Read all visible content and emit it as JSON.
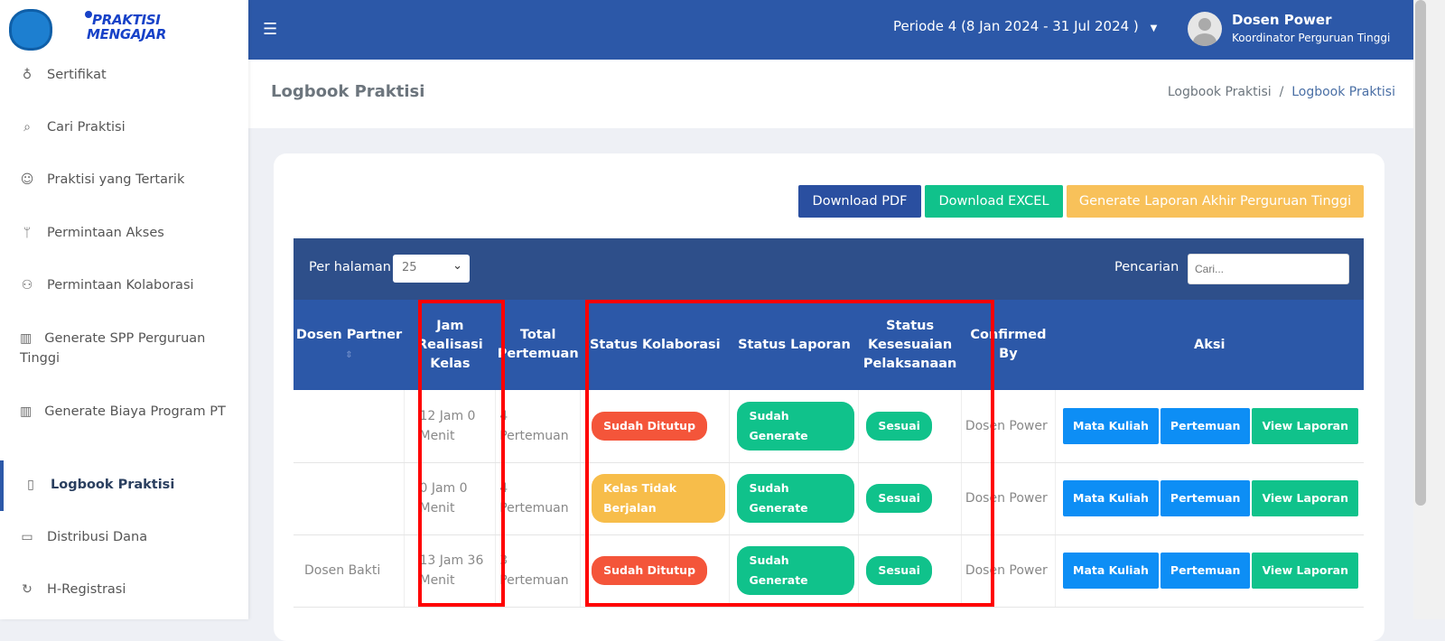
{
  "brand": {
    "logo_text_1": "PRAKTISI",
    "logo_text_2": "MENGAJAR"
  },
  "sidebar": {
    "items": [
      {
        "label": "Sertifikat",
        "icon": "award-icon"
      },
      {
        "label": "Cari Praktisi",
        "icon": "search-icon"
      },
      {
        "label": "Praktisi yang Tertarik",
        "icon": "smile-icon"
      },
      {
        "label": "Permintaan Akses",
        "icon": "antenna-icon"
      },
      {
        "label": "Permintaan Kolaborasi",
        "icon": "users-icon"
      },
      {
        "label": "Generate SPP Perguruan Tinggi",
        "icon": "sliders-icon"
      },
      {
        "label": "Generate Biaya Program PT",
        "icon": "sliders-icon"
      },
      {
        "label": "Logbook Praktisi",
        "icon": "book-icon",
        "active": true
      },
      {
        "label": "Distribusi Dana",
        "icon": "wallet-icon"
      },
      {
        "label": "H-Registrasi",
        "icon": "refresh-icon"
      }
    ]
  },
  "topbar": {
    "periode": "Periode 4 (8 Jan 2024 - 31 Jul 2024 )",
    "user_name": "Dosen Power",
    "user_role": "Koordinator Perguruan Tinggi"
  },
  "page": {
    "title": "Logbook Praktisi",
    "breadcrumb": [
      "Logbook Praktisi",
      "Logbook Praktisi"
    ]
  },
  "actions": {
    "pdf": "Download PDF",
    "excel": "Download EXCEL",
    "generate": "Generate Laporan Akhir Perguruan Tinggi"
  },
  "table_tools": {
    "per_page_label": "Per halaman",
    "per_page_value": "25",
    "search_label": "Pencarian",
    "search_placeholder": "Cari..."
  },
  "columns": [
    "Dosen Partner",
    "Jam Realisasi Kelas",
    "Total Pertemuan",
    "Status Kolaborasi",
    "Status Laporan",
    "Status Kesesuaian Pelaksanaan",
    "Confirmed By",
    "Aksi"
  ],
  "rows": [
    {
      "dosen": "",
      "jam": "12 Jam 0 Menit",
      "total": "4 Pertemuan",
      "kolaborasi": "Sudah Ditutup",
      "kolaborasi_color": "#f4553a",
      "laporan": "Sudah Generate",
      "kesesuaian": "Sesuai",
      "confirmed": "Dosen Power"
    },
    {
      "dosen": "",
      "jam": "0 Jam 0 Menit",
      "total": "4 Pertemuan",
      "kolaborasi": "Kelas Tidak Berjalan",
      "kolaborasi_color": "#f7bd4a",
      "laporan": "Sudah Generate",
      "kesesuaian": "Sesuai",
      "confirmed": "Dosen Power"
    },
    {
      "dosen": "Dosen Bakti",
      "jam": "13 Jam 36 Menit",
      "total": "3 Pertemuan",
      "kolaborasi": "Sudah Ditutup",
      "kolaborasi_color": "#f4553a",
      "laporan": "Sudah Generate",
      "kesesuaian": "Sesuai",
      "confirmed": "Dosen Power"
    }
  ],
  "row_actions": {
    "mata_kuliah": "Mata Kuliah",
    "pertemuan": "Pertemuan",
    "view_laporan": "View Laporan"
  },
  "colors": {
    "primary": "#2c58a8",
    "green": "#10c28b",
    "blue_btn": "#0d8ef5",
    "yellow": "#f8c15a",
    "highlight": "#ff0000"
  }
}
